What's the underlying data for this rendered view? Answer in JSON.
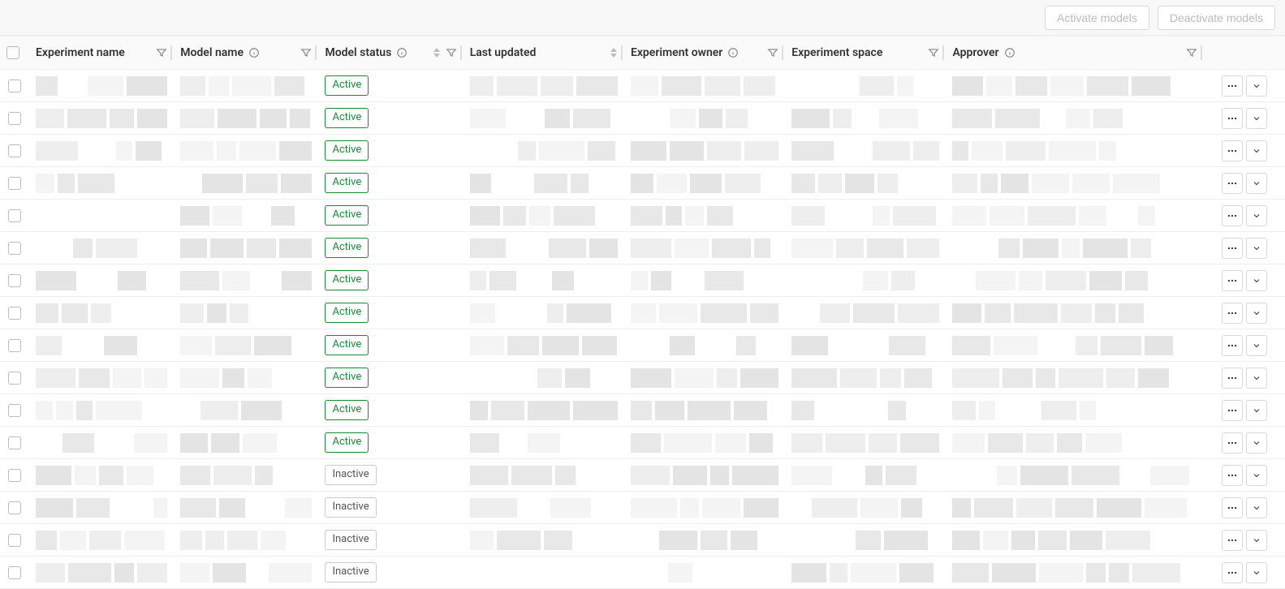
{
  "toolbar": {
    "activate_label": "Activate models",
    "deactivate_label": "Deactivate models"
  },
  "columns": {
    "experiment_name": "Experiment name",
    "model_name": "Model name",
    "model_status": "Model status",
    "last_updated": "Last updated",
    "experiment_owner": "Experiment owner",
    "experiment_space": "Experiment space",
    "approver": "Approver"
  },
  "status_labels": {
    "active": "Active",
    "inactive": "Inactive"
  },
  "rows": [
    {
      "status": "active"
    },
    {
      "status": "active"
    },
    {
      "status": "active"
    },
    {
      "status": "active"
    },
    {
      "status": "active"
    },
    {
      "status": "active"
    },
    {
      "status": "active"
    },
    {
      "status": "active"
    },
    {
      "status": "active"
    },
    {
      "status": "active"
    },
    {
      "status": "active"
    },
    {
      "status": "active"
    },
    {
      "status": "inactive"
    },
    {
      "status": "inactive"
    },
    {
      "status": "inactive"
    },
    {
      "status": "inactive"
    }
  ],
  "skeleton_palette": [
    "#f4f4f4",
    "#eeeeee",
    "#e8e8e8",
    "#e4e4e4",
    "#ffffff"
  ]
}
